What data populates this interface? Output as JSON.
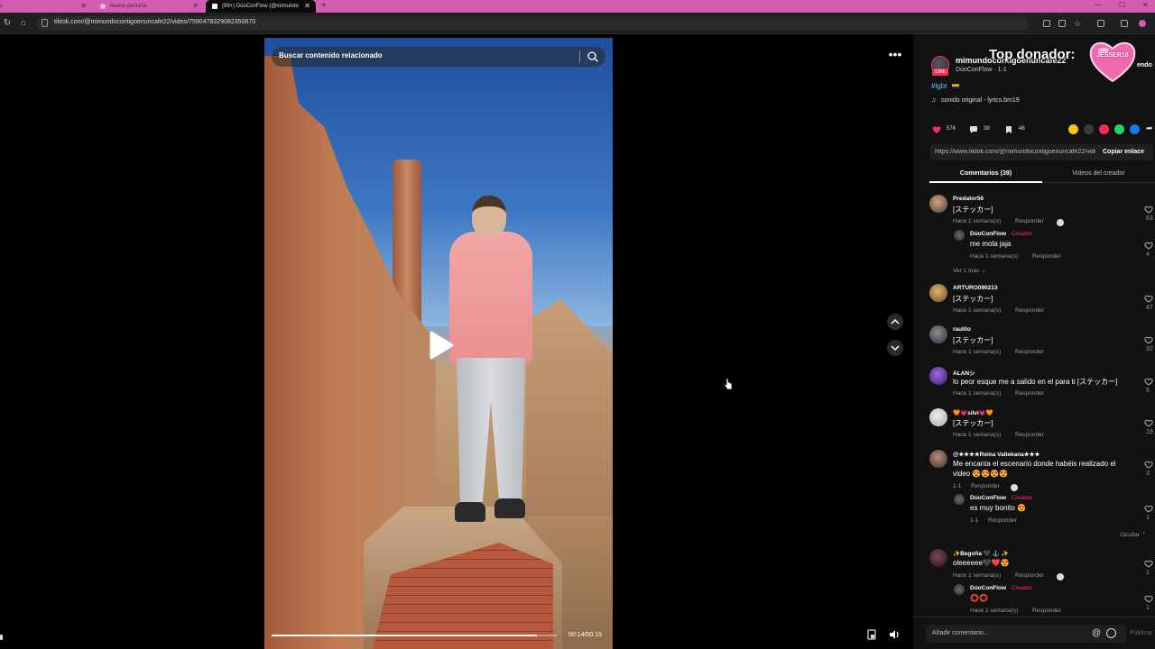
{
  "browser": {
    "tabs": [
      {
        "label": "s"
      },
      {
        "label": "Nueva pestaña"
      },
      {
        "label": "(99+) DúoConFlow (@mimundo"
      }
    ],
    "url": "tiktok.com/@mimundocontigoenuncafe22/video/7590478329082350870"
  },
  "video": {
    "search_placeholder": "Buscar contenido relacionado",
    "time": "00:14/00:15",
    "progress": 0.93
  },
  "panel": {
    "creator_handle": "mimundocontigoenuncafe22",
    "creator_sub": "DúoConFlow · 1-1",
    "live_badge": "LIVE",
    "overlay_title": "Top donador:",
    "overlay_name": "JESSER18",
    "follow_tail": "endo",
    "hashtag": "#lgbt",
    "music_icon": "♫",
    "sound": "sonido original - lyrics.bm19",
    "likes": "576",
    "comments_count": "39",
    "saves": "48",
    "share_colors": [
      "#f5c518",
      "#3a3a3a",
      "#fe2c55",
      "#25d366",
      "#1877f2"
    ],
    "link": "https://www.tiktok.com/@mimundocontigoenuncafe22/video/7590478329082350870",
    "copy_link": "Copiar enlace",
    "tab_comments": "Comentarios (39)",
    "tab_creator_videos": "Videos del creador",
    "view_more": "Ver 1 más ⌄",
    "hide": "Ocultar ⌃",
    "comment_placeholder": "Añadir comentario...",
    "mention_icon": "@",
    "publish": "Publicar"
  },
  "comments": [
    {
      "user": "Predator56",
      "text": "[ステッカー]",
      "meta": "Hace 1 semana(s)",
      "reply": "Responder",
      "likes": "63"
    },
    {
      "user": "DúoConFlow",
      "badge": " · Creador",
      "text": "me mola jaja",
      "meta": "Hace 1 semana(s)",
      "reply": "Responder",
      "likes": "4"
    },
    {
      "user": "ARTURO090213",
      "text": "[ステッカー]",
      "meta": "Hace 1 semana(s)",
      "reply": "Responder",
      "likes": "47"
    },
    {
      "user": "raulito",
      "text": "[ステッカー]",
      "meta": "Hace 1 semana(s)",
      "reply": "Responder",
      "likes": "32"
    },
    {
      "user": "ALANシ",
      "text": "lo peor esque me a salido en el para ti [ステッカー]",
      "meta": "Hace 1 semana(s)",
      "reply": "Responder",
      "likes": "5"
    },
    {
      "user": "🧡💗silvi💗🧡",
      "text": "[ステッカー]",
      "meta": "Hace 1 semana(s)",
      "reply": "Responder",
      "likes": "19"
    },
    {
      "user": "@★★★★Reina Vallekana★★★",
      "text": "Me encanta el escenario donde habéis realizado el",
      "text2": "video 😍😍😍😍",
      "meta": "1-1",
      "reply": "Responder",
      "likes": "3"
    },
    {
      "user": "DúoConFlow",
      "badge": " · Creador",
      "text": "es muy bonito 😍",
      "meta": "1-1",
      "reply": "Responder",
      "likes": "1"
    },
    {
      "user": "✨Begoña 🖤 ⚓ ✨",
      "text": "oleeeeee🖤❤️😍",
      "meta": "Hace 1 semana(s)",
      "reply": "Responder",
      "likes": "1"
    },
    {
      "user": "DúoConFlow",
      "badge": " · Creador",
      "text": "⭕⭕",
      "meta": "Hace 1 semana(s)",
      "reply": "Responder",
      "likes": "1"
    }
  ]
}
